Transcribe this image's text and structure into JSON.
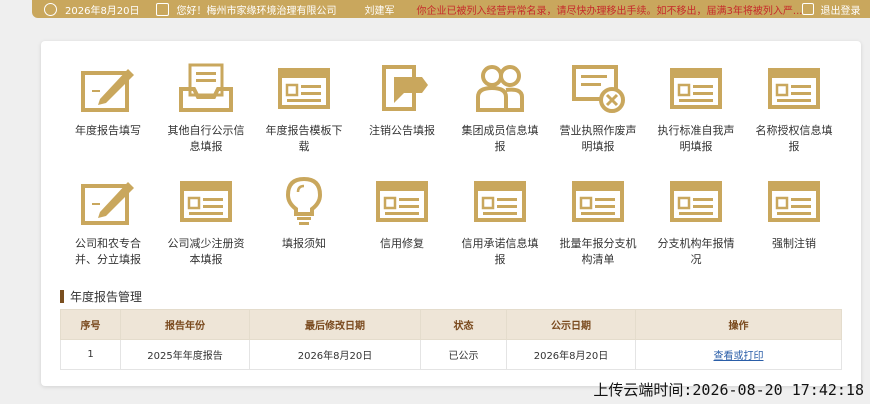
{
  "topbar": {
    "date": "2026年8月20日",
    "greeting": "您好！梅州市家缘环境治理有限公司",
    "user": "刘建军",
    "warning": "你企业已被列入经营异常名录，请尽快办理移出手续。如不移出，届满3年将被列入严...",
    "logout": "退出登录"
  },
  "tiles": [
    {
      "label": "年度报告填写",
      "icon": "form-pen-icon"
    },
    {
      "label": "其他自行公示信息填报",
      "icon": "inbox-tray-icon"
    },
    {
      "label": "年度报告模板下载",
      "icon": "window-list-icon"
    },
    {
      "label": "注销公告填报",
      "icon": "document-fold-icon"
    },
    {
      "label": "集团成员信息填报",
      "icon": "group-users-icon"
    },
    {
      "label": "营业执照作废声明填报",
      "icon": "license-void-icon"
    },
    {
      "label": "执行标准自我声明填报",
      "icon": "window-list-icon"
    },
    {
      "label": "名称授权信息填报",
      "icon": "window-list-icon"
    },
    {
      "label": "公司和农专合并、分立填报",
      "icon": "form-pen-icon"
    },
    {
      "label": "公司减少注册资本填报",
      "icon": "window-list-icon"
    },
    {
      "label": "填报须知",
      "icon": "lightbulb-icon"
    },
    {
      "label": "信用修复",
      "icon": "window-list-icon"
    },
    {
      "label": "信用承诺信息填报",
      "icon": "window-list-icon"
    },
    {
      "label": "批量年报分支机构清单",
      "icon": "window-list-icon"
    },
    {
      "label": "分支机构年报情况",
      "icon": "window-list-icon"
    },
    {
      "label": "强制注销",
      "icon": "window-list-icon"
    }
  ],
  "section": {
    "title": "年度报告管理"
  },
  "table": {
    "headers": [
      "序号",
      "报告年份",
      "最后修改日期",
      "状态",
      "公示日期",
      "操作"
    ],
    "rows": [
      [
        "1",
        "2025年年度报告",
        "2026年8月20日",
        "已公示",
        "2026年8月20日",
        "查看或打印"
      ]
    ]
  },
  "footer": {
    "upload_time": "上传云端时间:2026-08-20 17:42:18"
  },
  "colors": {
    "accent": "#c9a75d",
    "header_bg": "#eee5d7",
    "link": "#2a5ea8",
    "warning": "#c62b2b"
  }
}
